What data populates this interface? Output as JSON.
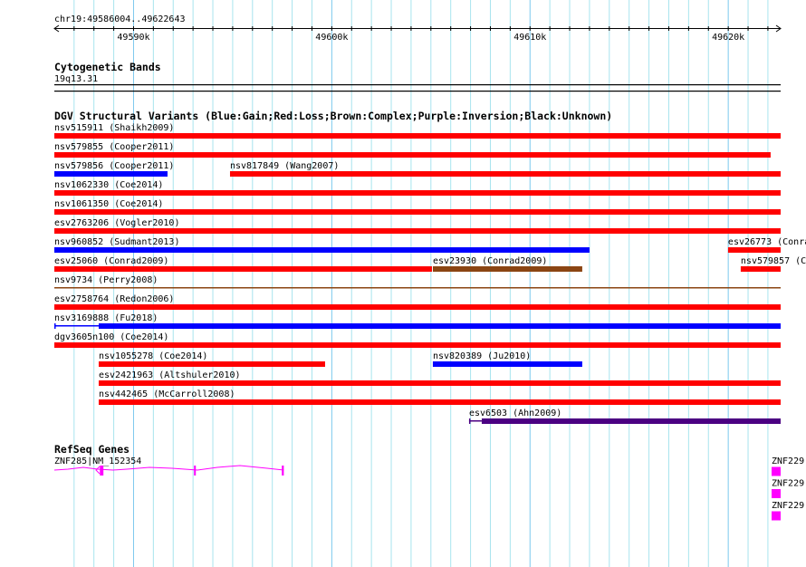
{
  "ruler": {
    "label": "chr19:49586004..49622643",
    "start": 49586004,
    "end": 49622643,
    "major_ticks": [
      {
        "pos": 49590000,
        "label": "49590k"
      },
      {
        "pos": 49600000,
        "label": "49600k"
      },
      {
        "pos": 49610000,
        "label": "49610k"
      },
      {
        "pos": 49620000,
        "label": "49620k"
      }
    ]
  },
  "colors": {
    "gain": "#0000ff",
    "loss": "#ff0000",
    "complex": "#8b4513",
    "inversion": "#4b0082",
    "gene": "#ff00ff",
    "grid_minor": "#a8e4ee",
    "grid_major": "#7cc8ee"
  },
  "cytoband": {
    "title": "Cytogenetic Bands",
    "band": "19q13.31"
  },
  "dgv": {
    "title": "DGV Structural Variants (Blue:Gain;Red:Loss;Brown:Complex;Purple:Inversion;Black:Unknown)",
    "rows": [
      [
        {
          "label": "nsv515911 (Shaikh2009)",
          "start": 49586004,
          "end": 49622643,
          "type": "loss"
        }
      ],
      [
        {
          "label": "nsv579855 (Cooper2011)",
          "start": 49586004,
          "end": 49622137,
          "type": "loss"
        }
      ],
      [
        {
          "label": "nsv579856 (Cooper2011)",
          "start": 49586004,
          "end": 49591714,
          "type": "gain"
        },
        {
          "label": "nsv817849 (Wang2007)",
          "start": 49594866,
          "end": 49622643,
          "type": "loss"
        }
      ],
      [
        {
          "label": "nsv1062330 (Coe2014)",
          "start": 49586004,
          "end": 49622643,
          "type": "loss"
        }
      ],
      [
        {
          "label": "nsv1061350 (Coe2014)",
          "start": 49586004,
          "end": 49622643,
          "type": "loss"
        }
      ],
      [
        {
          "label": "esv2763206 (Vogler2010)",
          "start": 49586004,
          "end": 49622643,
          "type": "loss"
        }
      ],
      [
        {
          "label": "nsv960852 (Sudmant2013)",
          "start": 49586004,
          "end": 49613001,
          "type": "gain"
        },
        {
          "label": "esv26773 (Conra",
          "start": 49619990,
          "end": 49622643,
          "type": "loss"
        }
      ],
      [
        {
          "label": "esv25060 (Conrad2009)",
          "start": 49586004,
          "end": 49605053,
          "type": "loss"
        },
        {
          "label": "esv23930 (Conrad2009)",
          "start": 49605098,
          "end": 49612635,
          "type": "complex"
        },
        {
          "label": "nsv579857 (C",
          "start": 49620629,
          "end": 49622643,
          "type": "loss"
        }
      ],
      [
        {
          "label": "nsv9734 (Perry2008)",
          "start": 49586004,
          "end": 49622643,
          "type": "complex",
          "thin": true
        }
      ],
      [
        {
          "label": "esv2758764 (Redon2006)",
          "start": 49586004,
          "end": 49622643,
          "type": "loss"
        }
      ],
      [
        {
          "label": "nsv3169888 (Fu2018)",
          "start": 49586004,
          "end": 49622643,
          "thick_start": 49588242,
          "type": "gain"
        }
      ],
      [
        {
          "label": "dgv3605n100 (Coe2014)",
          "start": 49586004,
          "end": 49622643,
          "type": "loss"
        }
      ],
      [
        {
          "label": "nsv1055278 (Coe2014)",
          "start": 49588242,
          "end": 49599662,
          "type": "loss"
        },
        {
          "label": "nsv820389 (Ju2010)",
          "start": 49605098,
          "end": 49612635,
          "type": "gain"
        }
      ],
      [
        {
          "label": "esv2421963 (Altshuler2010)",
          "start": 49588242,
          "end": 49622643,
          "type": "loss"
        }
      ],
      [
        {
          "label": "nsv442465 (McCarroll2008)",
          "start": 49588242,
          "end": 49622643,
          "type": "loss"
        }
      ],
      [
        {
          "label": "esv6503 (Ahn2009)",
          "start": 49606925,
          "end": 49622643,
          "thick_start": 49607565,
          "type": "inversion"
        }
      ]
    ]
  },
  "refseq": {
    "title": "RefSeq Genes",
    "genes": [
      {
        "label": "ZNF285|NM_152354",
        "start": 49586004,
        "end": 49597580,
        "strand": "-",
        "exons": [
          [
            49588300,
            49588480
          ],
          [
            49593050,
            49593100
          ],
          [
            49597480,
            49597580
          ]
        ]
      },
      {
        "label": "ZNF229",
        "start": 49622150,
        "end": 49622643,
        "exons": [
          [
            49622150,
            49622643
          ]
        ]
      },
      {
        "label": "ZNF229",
        "start": 49622150,
        "end": 49622643,
        "exons": [
          [
            49622150,
            49622643
          ]
        ]
      },
      {
        "label": "ZNF229",
        "start": 49622150,
        "end": 49622643,
        "exons": [
          [
            49622150,
            49622643
          ]
        ]
      }
    ]
  }
}
